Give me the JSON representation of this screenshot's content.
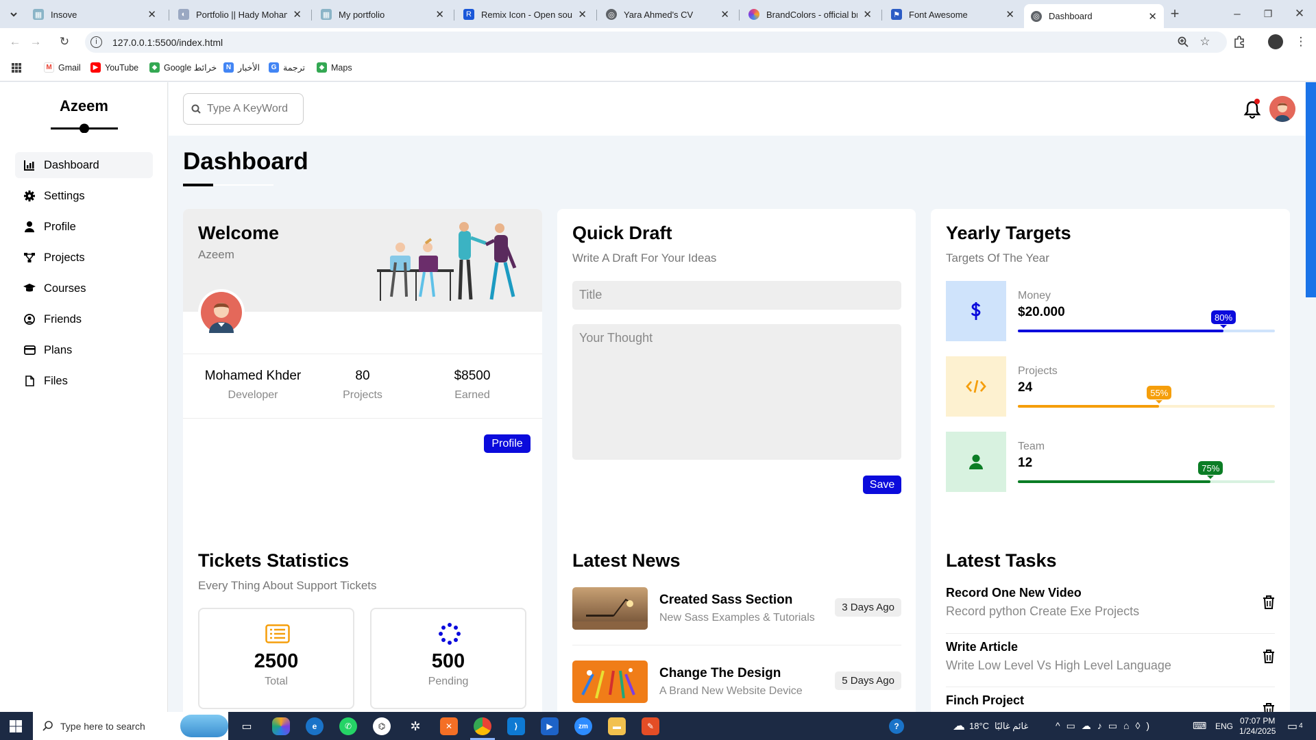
{
  "browser": {
    "tabs": [
      {
        "title": "Insove",
        "favicon_color": "#8ab4c7"
      },
      {
        "title": "Portfolio || Hady Mohamed",
        "favicon_color": "#9aa8c2"
      },
      {
        "title": "My portfolio",
        "favicon_color": "#8ab4c7"
      },
      {
        "title": "Remix Icon - Open source icon library",
        "favicon_color": "#1a57d8"
      },
      {
        "title": "Yara Ahmed's CV",
        "favicon_color": "#5f6368"
      },
      {
        "title": "BrandColors - official brand",
        "favicon_color": "#e04b7a"
      },
      {
        "title": "Font Awesome",
        "favicon_color": "#2c5cc5"
      },
      {
        "title": "Dashboard",
        "favicon_color": "#5f6368"
      }
    ],
    "url": "127.0.0.1:5500/index.html",
    "bookmarks": [
      "Gmail",
      "YouTube",
      "Google خرائط",
      "الأخبار",
      "ترجمة",
      "Maps"
    ]
  },
  "sidebar": {
    "brand": "Azeem",
    "items": [
      {
        "label": "Dashboard",
        "icon": "chart-icon"
      },
      {
        "label": "Settings",
        "icon": "gear-icon"
      },
      {
        "label": "Profile",
        "icon": "user-icon"
      },
      {
        "label": "Projects",
        "icon": "diagram-icon"
      },
      {
        "label": "Courses",
        "icon": "graduation-cap-icon"
      },
      {
        "label": "Friends",
        "icon": "user-circle-icon"
      },
      {
        "label": "Plans",
        "icon": "credit-card-icon"
      },
      {
        "label": "Files",
        "icon": "file-icon"
      }
    ]
  },
  "header": {
    "search_placeholder": "Type A KeyWord"
  },
  "main": {
    "title": "Dashboard",
    "welcome": {
      "title": "Welcome",
      "name": "Azeem",
      "user_name": "Mohamed Khder",
      "user_role": "Developer",
      "projects_value": "80",
      "projects_label": "Projects",
      "earned_value": "$8500",
      "earned_label": "Earned",
      "button": "Profile"
    },
    "draft": {
      "title": "Quick Draft",
      "subtitle": "Write A Draft For Your Ideas",
      "title_placeholder": "Title",
      "body_placeholder": "Your Thought",
      "button": "Save"
    },
    "targets": {
      "title": "Yearly Targets",
      "subtitle": "Targets Of The Year",
      "items": [
        {
          "label": "Money",
          "value": "$20.000",
          "percent": 80,
          "percent_text": "80%",
          "icon": "dollar-icon",
          "color": "#0b0bdc",
          "bg": "#cfe3fb"
        },
        {
          "label": "Projects",
          "value": "24",
          "percent": 55,
          "percent_text": "55%",
          "icon": "code-icon",
          "color": "#f59e0b",
          "bg": "#fdf1d0"
        },
        {
          "label": "Team",
          "value": "12",
          "percent": 75,
          "percent_text": "75%",
          "icon": "user-icon",
          "color": "#0b7d25",
          "bg": "#d8f2e0"
        }
      ]
    },
    "tickets": {
      "title": "Tickets Statistics",
      "subtitle": "Every Thing About Support Tickets",
      "items": [
        {
          "value": "2500",
          "label": "Total",
          "icon": "list-icon"
        },
        {
          "value": "500",
          "label": "Pending",
          "icon": "spinner-icon"
        }
      ]
    },
    "news": {
      "title": "Latest News",
      "items": [
        {
          "title": "Created Sass Section",
          "desc": "New Sass Examples & Tutorials",
          "ago": "3 Days Ago"
        },
        {
          "title": "Change The Design",
          "desc": "A Brand New Website Device",
          "ago": "5 Days Ago"
        }
      ]
    },
    "tasks": {
      "title": "Latest Tasks",
      "items": [
        {
          "title": "Record One New Video",
          "desc": "Record python Create Exe Projects"
        },
        {
          "title": "Write Article",
          "desc": "Write Low Level Vs High Level Language"
        },
        {
          "title": "Finch Project",
          "desc": ""
        }
      ]
    }
  },
  "taskbar": {
    "search_placeholder": "Type here to search",
    "weather": "18°C",
    "weather_text": "غائم غالبًا",
    "lang": "ENG",
    "time": "07:07 PM",
    "date": "1/24/2025",
    "notification_count": "4"
  }
}
